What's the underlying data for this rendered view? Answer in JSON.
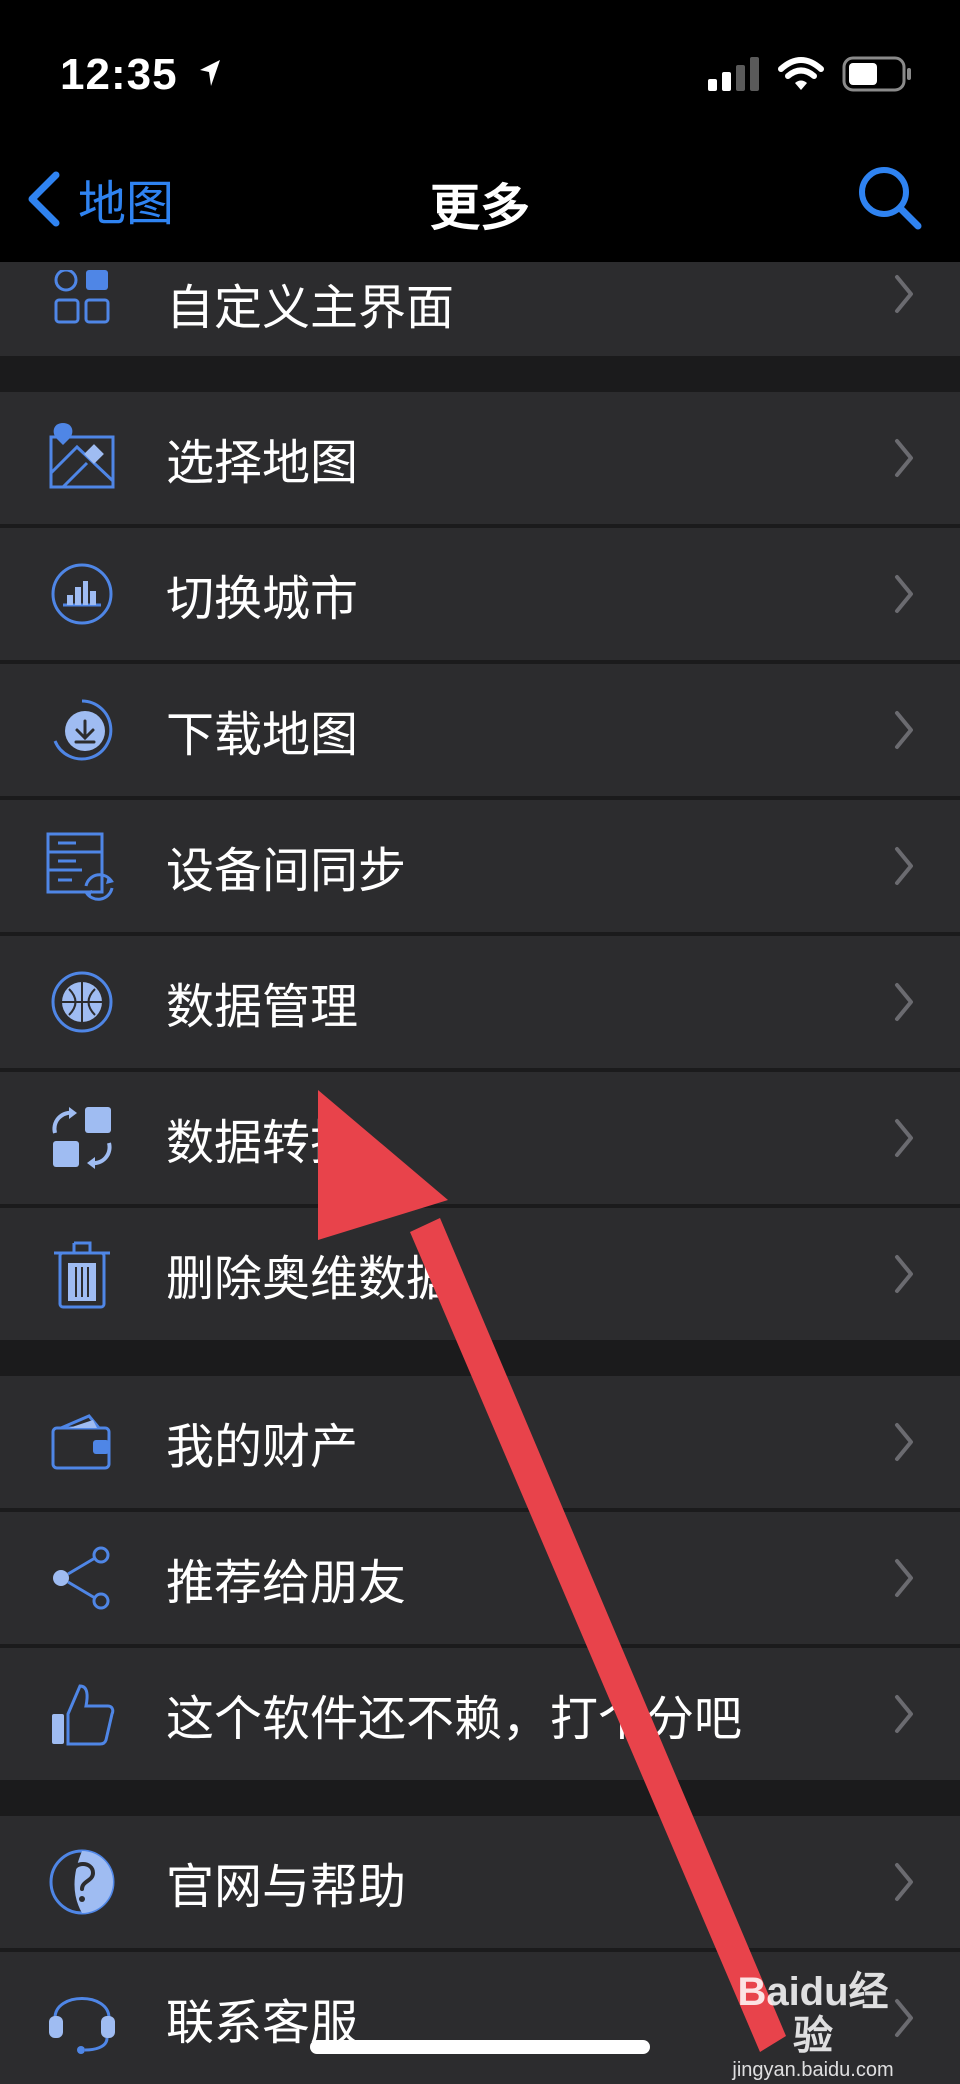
{
  "status": {
    "time": "12:35"
  },
  "nav": {
    "back_label": "地图",
    "title": "更多"
  },
  "groups": [
    [
      {
        "label": "自定义主界面",
        "icon": "grid-layout-icon"
      }
    ],
    [
      {
        "label": "选择地图",
        "icon": "map-pin-icon"
      },
      {
        "label": "切换城市",
        "icon": "city-icon"
      },
      {
        "label": "下载地图",
        "icon": "download-icon"
      },
      {
        "label": "设备间同步",
        "icon": "sync-icon"
      },
      {
        "label": "数据管理",
        "icon": "globe-icon"
      },
      {
        "label": "数据转换",
        "icon": "convert-icon"
      },
      {
        "label": "删除奥维数据",
        "icon": "trash-icon"
      }
    ],
    [
      {
        "label": "我的财产",
        "icon": "wallet-icon"
      },
      {
        "label": "推荐给朋友",
        "icon": "share-icon"
      },
      {
        "label": "这个软件还不赖，打个分吧",
        "icon": "thumbs-up-icon"
      }
    ],
    [
      {
        "label": "官网与帮助",
        "icon": "help-icon"
      },
      {
        "label": "联系客服",
        "icon": "headset-icon"
      }
    ]
  ],
  "watermark": {
    "logo": "Baidu经验",
    "url": "jingyan.baidu.com"
  },
  "colors": {
    "accent": "#2f83f1",
    "icon": "#4f86e6",
    "arrow": "#e8434b",
    "cell": "#2c2c2e",
    "background": "#1b1b1c"
  }
}
